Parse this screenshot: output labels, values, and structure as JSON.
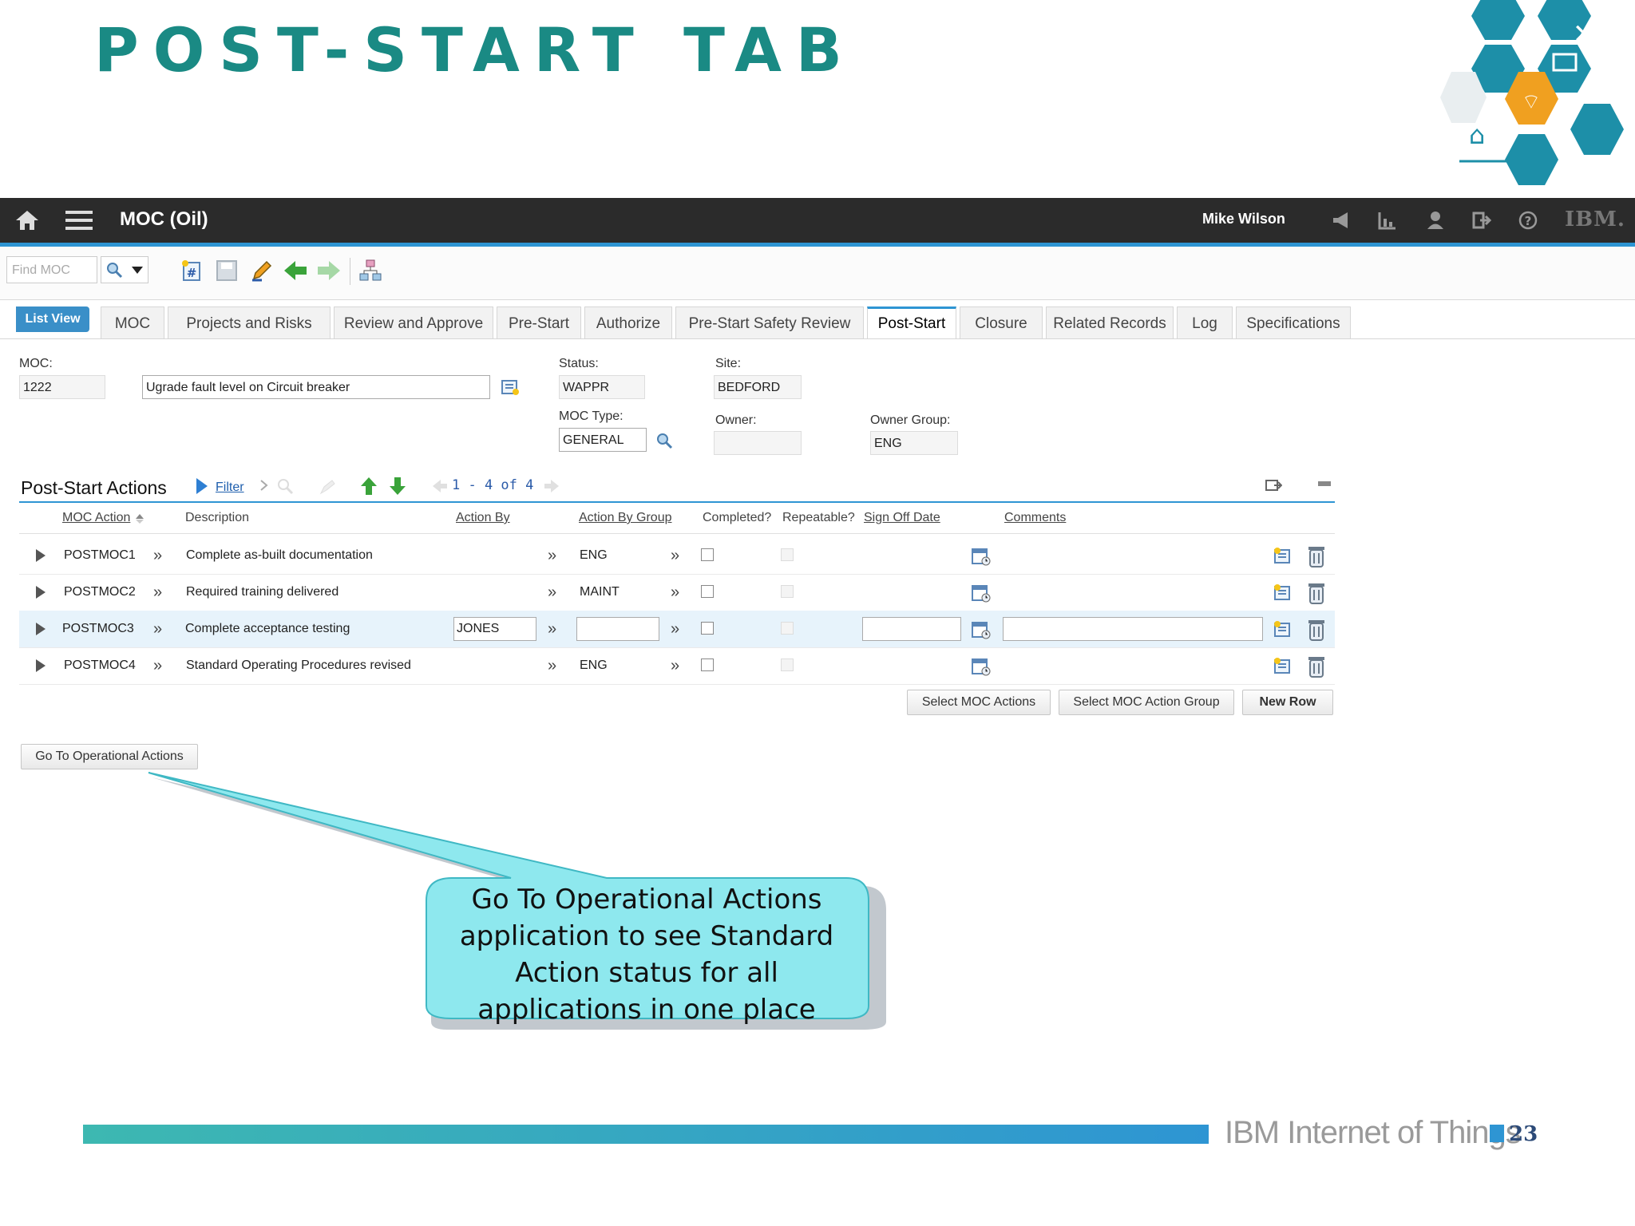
{
  "slide": {
    "title": "POST-START TAB",
    "footer_brand": "IBM Internet of Things",
    "page_number": "23",
    "callout": "Go To Operational Actions application to see Standard Action status for all applications in one place"
  },
  "topbar": {
    "app_title": "MOC (Oil)",
    "user_name": "Mike Wilson",
    "brand": "IBM."
  },
  "toolbar": {
    "find_placeholder": "Find MOC"
  },
  "tabs": {
    "list_view": "List View",
    "items": [
      "MOC",
      "Projects and Risks",
      "Review and Approve",
      "Pre-Start",
      "Authorize",
      "Pre-Start Safety Review",
      "Post-Start",
      "Closure",
      "Related Records",
      "Log",
      "Specifications"
    ],
    "active": "Post-Start"
  },
  "header": {
    "moc_label": "MOC:",
    "moc_value": "1222",
    "description": "Ugrade fault level on Circuit breaker",
    "status_label": "Status:",
    "status_value": "WAPPR",
    "site_label": "Site:",
    "site_value": "BEDFORD",
    "moc_type_label": "MOC Type:",
    "moc_type_value": "GENERAL",
    "owner_label": "Owner:",
    "owner_value": "",
    "owner_group_label": "Owner Group:",
    "owner_group_value": "ENG"
  },
  "section": {
    "title": "Post-Start Actions",
    "filter": "Filter",
    "pager": "1 - 4 of 4",
    "columns": [
      "MOC Action",
      "Description",
      "Action By",
      "Action By Group",
      "Completed?",
      "Repeatable?",
      "Sign Off Date",
      "Comments"
    ],
    "rows": [
      {
        "action": "POSTMOC1",
        "description": "Complete as-built documentation",
        "action_by": "",
        "group": "ENG"
      },
      {
        "action": "POSTMOC2",
        "description": "Required training delivered",
        "action_by": "",
        "group": "MAINT"
      },
      {
        "action": "POSTMOC3",
        "description": "Complete acceptance testing",
        "action_by": "JONES",
        "group": ""
      },
      {
        "action": "POSTMOC4",
        "description": "Standard Operating Procedures revised",
        "action_by": "",
        "group": "ENG"
      }
    ],
    "buttons": {
      "select_actions": "Select MOC Actions",
      "select_group": "Select MOC Action Group",
      "new_row": "New Row"
    }
  },
  "go_to_button": "Go To Operational Actions",
  "colors": {
    "accent": "#2e95d3",
    "title_teal": "#1a8a84",
    "callout": "#8ee8ee",
    "topbar": "#2b2b2b"
  }
}
